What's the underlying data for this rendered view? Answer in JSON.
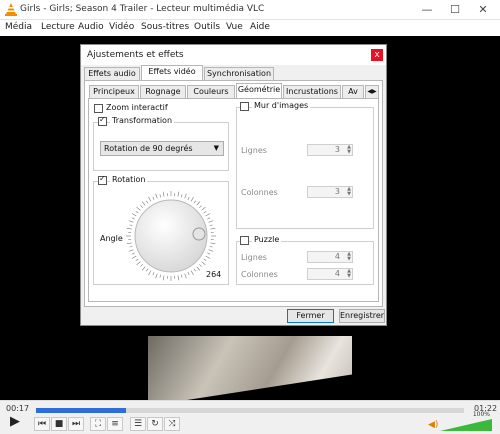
{
  "window": {
    "title": "Girls - Girls; Season 4 Trailer - Lecteur multimédia VLC",
    "minimize": "—",
    "maximize": "☐",
    "close": "✕"
  },
  "menu": [
    "Média",
    "Lecture",
    "Audio",
    "Vidéo",
    "Sous-titres",
    "Outils",
    "Vue",
    "Aide"
  ],
  "player": {
    "elapsed": "00:17",
    "total": "01:22",
    "progress": 0.21,
    "volume_label": "100%"
  },
  "dialog": {
    "title": "Ajustements et effets",
    "close": "x",
    "main_tabs": [
      "Effets audio",
      "Effets vidéo",
      "Synchronisation"
    ],
    "sub_tabs": [
      "Principeux",
      "Rognage",
      "Couleurs",
      "Géométrie",
      "Incrustations",
      "Av"
    ],
    "sub_tab_arrows": "◀▶",
    "geometry": {
      "zoom_label": "Zoom interactif",
      "transform_label": "Transformation",
      "transform_value": "Rotation de 90 degrés",
      "rotation_label": "Rotation",
      "angle_label": "Angle",
      "angle_value": "264",
      "wall_label": "Mur d'images",
      "rows_label": "Lignes",
      "rows_value": "3",
      "cols_label": "Colonnes",
      "cols_value": "3",
      "puzzle_label": "Puzzle",
      "puzzle_rows_label": "Lignes",
      "puzzle_rows_value": "4",
      "puzzle_cols_label": "Colonnes",
      "puzzle_cols_value": "4"
    },
    "buttons": {
      "close": "Fermer",
      "save": "Enregistrer"
    }
  }
}
